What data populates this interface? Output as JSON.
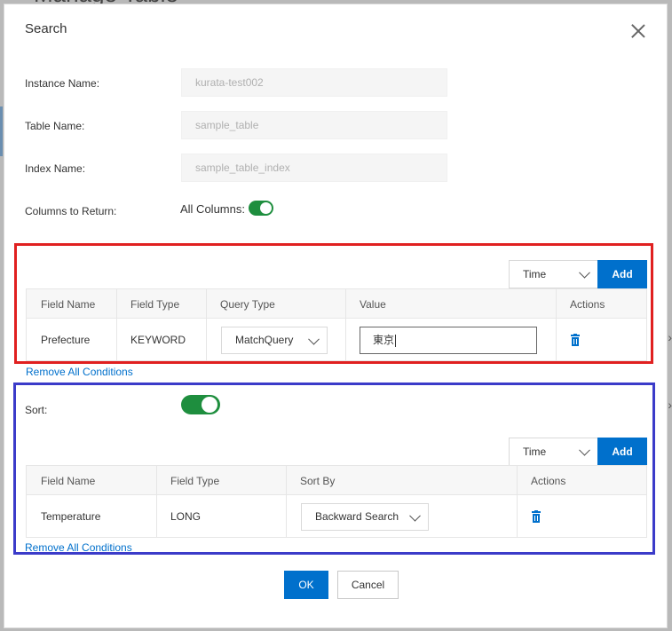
{
  "background": {
    "page_title": "Manage Table"
  },
  "dialog": {
    "title": "Search",
    "fields": {
      "instance_label": "Instance Name:",
      "instance_value": "kurata-test002",
      "table_label": "Table Name:",
      "table_value": "sample_table",
      "index_label": "Index Name:",
      "index_value": "sample_table_index",
      "columns_label": "Columns to Return:",
      "all_columns_label": "All Columns:",
      "all_columns_on": true
    },
    "query": {
      "field_select": "Time",
      "add_label": "Add",
      "headers": [
        "Field Name",
        "Field Type",
        "Query Type",
        "Value",
        "Actions"
      ],
      "rows": [
        {
          "field_name": "Prefecture",
          "field_type": "KEYWORD",
          "query_type": "MatchQuery",
          "value": "東京"
        }
      ],
      "remove_all": "Remove All Conditions"
    },
    "sort": {
      "label": "Sort:",
      "enabled": true,
      "field_select": "Time",
      "add_label": "Add",
      "headers": [
        "Field Name",
        "Field Type",
        "Sort By",
        "Actions"
      ],
      "rows": [
        {
          "field_name": "Temperature",
          "field_type": "LONG",
          "sort_by": "Backward Search"
        }
      ],
      "remove_all": "Remove All Conditions"
    },
    "footer": {
      "ok_label": "OK",
      "cancel_label": "Cancel"
    }
  },
  "colors": {
    "primary": "#0070cc",
    "toggle_on": "#1e8e3e",
    "highlight_red": "#e02020",
    "highlight_blue": "#3b3bc9"
  },
  "icons": {
    "close": "close-icon",
    "delete": "trash-icon",
    "dropdown": "chevron-down-icon"
  }
}
